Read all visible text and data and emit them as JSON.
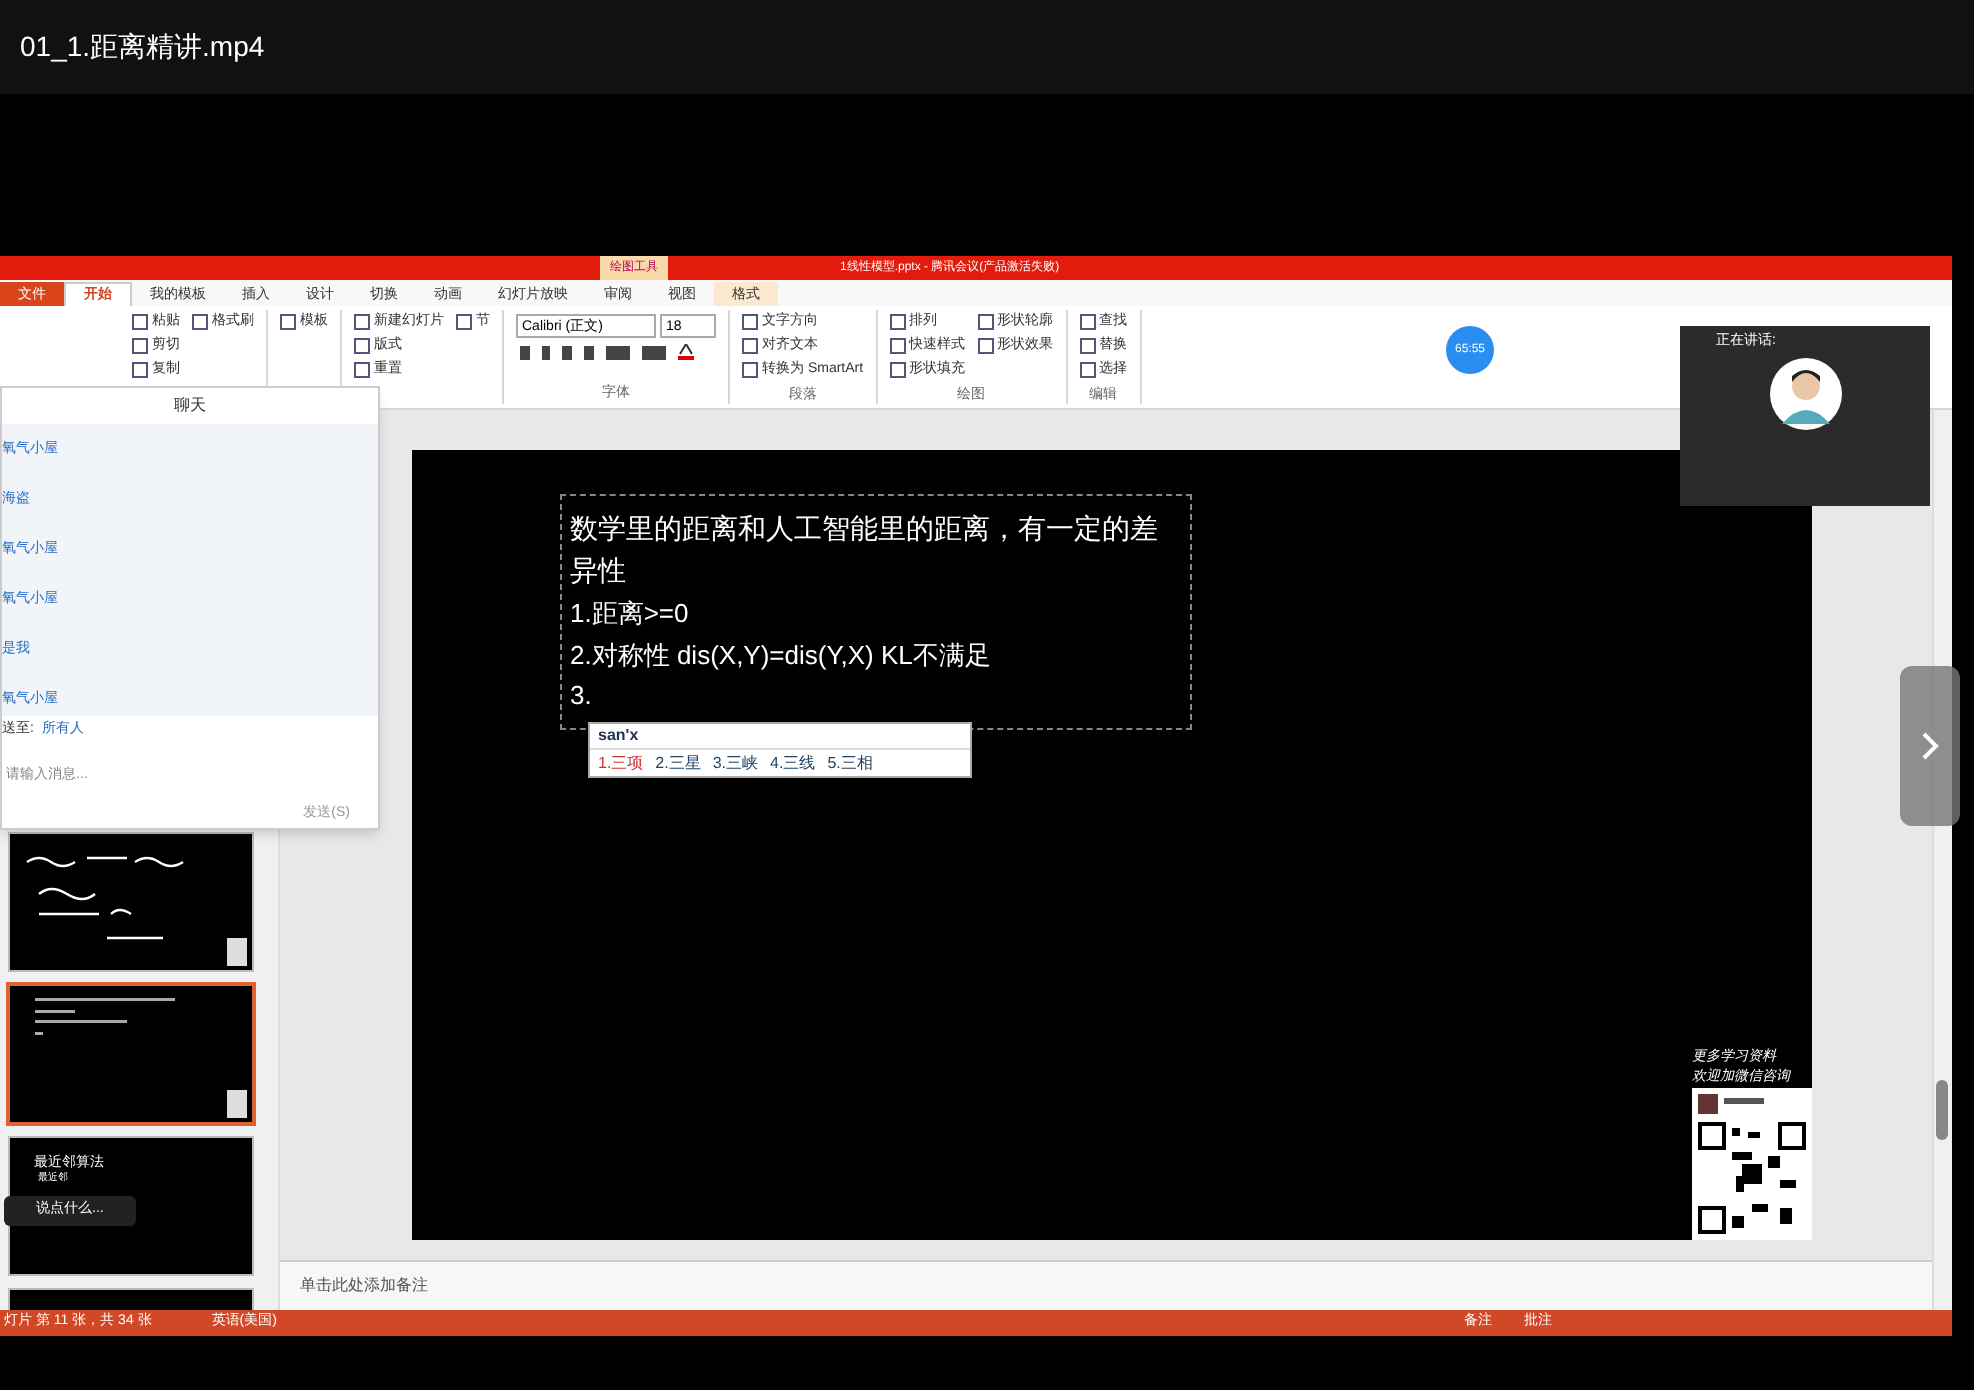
{
  "player": {
    "title": "01_1.距离精讲.mp4"
  },
  "app": {
    "title": "1线性模型.pptx - 腾讯会议(产品激活失败)",
    "context_tab": "绘图工具"
  },
  "tabs": [
    {
      "label": "文件",
      "selected": false,
      "kind": "file"
    },
    {
      "label": "开始",
      "selected": true,
      "kind": "tab"
    },
    {
      "label": "我的模板",
      "selected": false,
      "kind": "tab"
    },
    {
      "label": "插入",
      "selected": false,
      "kind": "tab"
    },
    {
      "label": "设计",
      "selected": false,
      "kind": "tab"
    },
    {
      "label": "切换",
      "selected": false,
      "kind": "tab"
    },
    {
      "label": "动画",
      "selected": false,
      "kind": "tab"
    },
    {
      "label": "幻灯片放映",
      "selected": false,
      "kind": "tab"
    },
    {
      "label": "审阅",
      "selected": false,
      "kind": "tab"
    },
    {
      "label": "视图",
      "selected": false,
      "kind": "tab"
    },
    {
      "label": "格式",
      "selected": false,
      "kind": "context"
    }
  ],
  "ribbon": [
    {
      "kind": "list",
      "items": [
        "粘贴",
        "剪切",
        "复制",
        "格式刷"
      ]
    },
    {
      "kind": "list",
      "items": [
        "模板"
      ]
    },
    {
      "kind": "list",
      "items": [
        "新建幻灯片",
        "版式",
        "重置",
        "节"
      ]
    },
    {
      "kind": "font",
      "font_name": "Calibri (正文)",
      "font_size": "18",
      "title": "字体"
    },
    {
      "kind": "list",
      "items": [
        "文字方向",
        "对齐文本",
        "转换为 SmartArt"
      ],
      "title": "段落"
    },
    {
      "kind": "list",
      "items": [
        "排列",
        "快速样式",
        "形状填充",
        "形状轮廓",
        "形状效果"
      ],
      "title": "绘图"
    },
    {
      "kind": "list",
      "items": [
        "查找",
        "替换",
        "选择"
      ],
      "title": "编辑"
    }
  ],
  "timer": "65:55",
  "camera": {
    "speaking": "正在讲话:"
  },
  "chat": {
    "title": "聊天",
    "messages": [
      "氧气小屋",
      "海盗",
      "氧气小屋",
      "氧气小屋",
      "是我",
      "氧气小屋"
    ],
    "send_to_label": "送至:",
    "recipient": "所有人",
    "placeholder": "请输入消息...",
    "send": "发送(S)"
  },
  "slide": {
    "lines": [
      "数学里的距离和人工智能里的距离，有一定的差异性",
      "1.距离>=0",
      "2.对称性 dis(X,Y)=dis(Y,X)  KL不满足",
      "3."
    ],
    "promo": [
      "更多学习资料",
      "欢迎加微信咨询"
    ]
  },
  "ime": {
    "input": "san'x",
    "candidates": [
      "1.三项",
      "2.三星",
      "3.三峡",
      "4.三线",
      "5.三相"
    ]
  },
  "thumbnails": [
    {
      "kind": "handwriting",
      "selected": false
    },
    {
      "kind": "text",
      "selected": true
    },
    {
      "kind": "titled",
      "title": "最近邻算法",
      "bullet": "最近邻",
      "selected": false
    },
    {
      "kind": "blank",
      "selected": false
    }
  ],
  "comment_bar": {
    "placeholder": "说点什么..."
  },
  "notes": {
    "placeholder": "单击此处添加备注"
  },
  "status": {
    "slide": "灯片 第 11 张，共 34 张",
    "language": "英语(美国)",
    "notes": "备注",
    "comments": "批注"
  }
}
